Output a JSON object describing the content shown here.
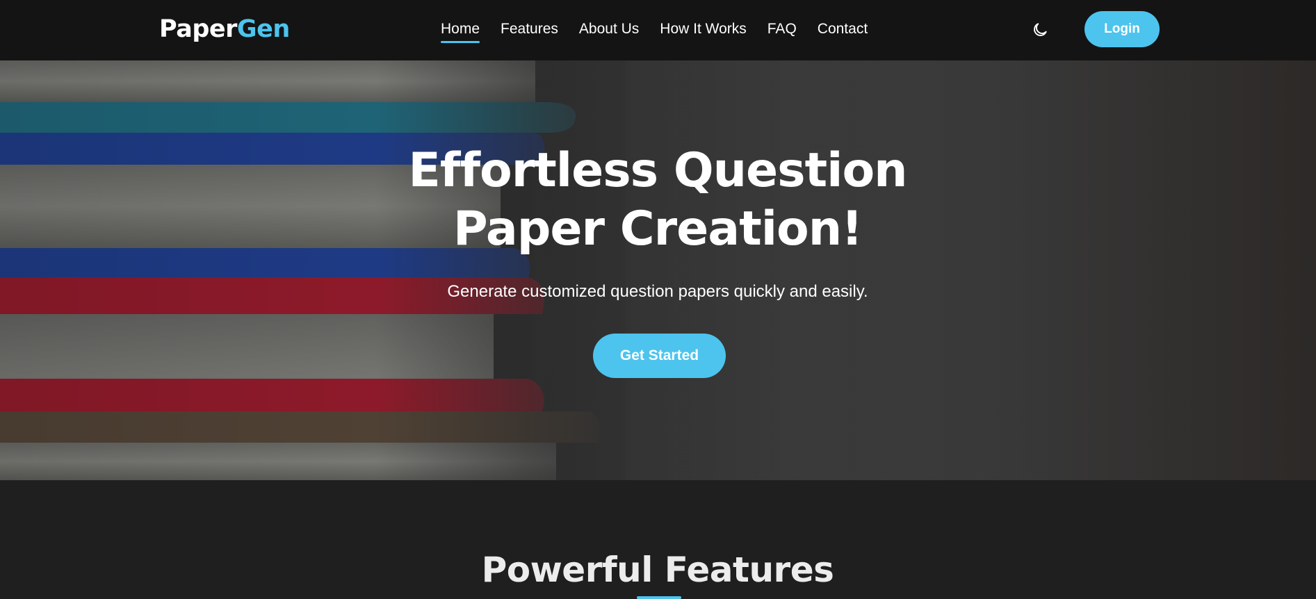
{
  "brand": {
    "name_part1": "Paper",
    "name_part2": "Gen",
    "accent_color": "#4cc4ee"
  },
  "nav": {
    "links": [
      {
        "label": "Home",
        "active": true
      },
      {
        "label": "Features",
        "active": false
      },
      {
        "label": "About Us",
        "active": false
      },
      {
        "label": "How It Works",
        "active": false
      },
      {
        "label": "FAQ",
        "active": false
      },
      {
        "label": "Contact",
        "active": false
      }
    ],
    "theme_toggle_icon": "moon-icon",
    "login_label": "Login"
  },
  "hero": {
    "title_line1": "Effortless Question",
    "title_line2": "Paper Creation!",
    "subtitle": "Generate customized question papers quickly and easily.",
    "cta_label": "Get Started",
    "background_image": "stack-of-books"
  },
  "features": {
    "title": "Powerful Features"
  }
}
